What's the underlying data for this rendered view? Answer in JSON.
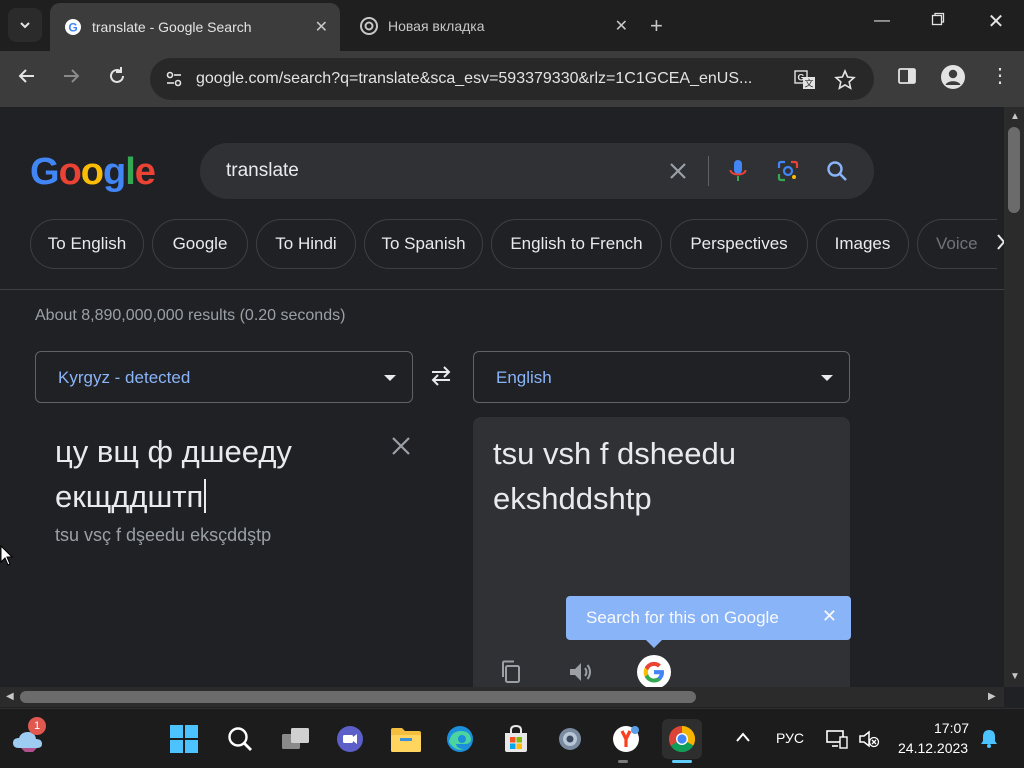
{
  "browser": {
    "tabs": [
      {
        "title": "translate - Google Search",
        "active": true
      },
      {
        "title": "Новая вкладка",
        "active": false
      }
    ],
    "url": "google.com/search?q=translate&sca_esv=593379330&rlz=1C1GCEA_enUS..."
  },
  "search": {
    "logo": "Google",
    "query": "translate"
  },
  "chips": [
    "To English",
    "Google",
    "To Hindi",
    "To Spanish",
    "English to French",
    "Perspectives",
    "Images",
    "Voice"
  ],
  "results_stats": "About 8,890,000,000 results (0.20 seconds)",
  "translate": {
    "source_language": "Kyrgyz - detected",
    "target_language": "English",
    "source_line1": "цу вщ ф дшееду",
    "source_line2": "екщддштп",
    "transliteration": "tsu vsç f dşeedu eksçddştp",
    "translation_line1": "tsu vsh f dsheedu",
    "translation_line2": "ekshddshtp",
    "tooltip": "Search for this on Google"
  },
  "taskbar": {
    "weather_badge": "1",
    "language": "РУС",
    "time": "17:07",
    "date": "24.12.2023"
  },
  "colors": {
    "accent": "#8ab4f8",
    "page_bg": "#202124",
    "card_bg": "#303134"
  }
}
